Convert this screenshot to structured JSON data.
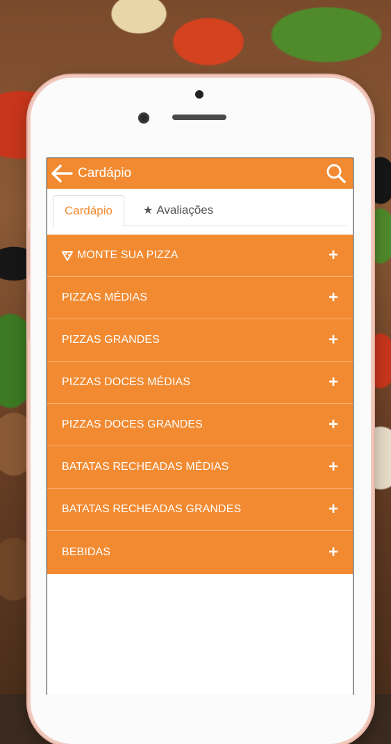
{
  "app": {
    "title": "Cardápio"
  },
  "tabs": [
    {
      "label": "Cardápio",
      "active": true
    },
    {
      "label": "Avaliações",
      "active": false,
      "icon": "star-icon"
    }
  ],
  "menu": {
    "items": [
      {
        "label": "MONTE SUA PIZZA",
        "icon": "pizza-slice-icon"
      },
      {
        "label": "PIZZAS MÉDIAS"
      },
      {
        "label": "PIZZAS GRANDES"
      },
      {
        "label": "PIZZAS DOCES MÉDIAS"
      },
      {
        "label": "PIZZAS DOCES GRANDES"
      },
      {
        "label": "BATATAS RECHEADAS MÉDIAS"
      },
      {
        "label": "BATATAS RECHEADAS GRANDES"
      },
      {
        "label": "BEBIDAS"
      }
    ],
    "expand_symbol": "+"
  },
  "colors": {
    "accent": "#f28a31",
    "divider": "#fbb37a",
    "phone_frame": "#f1c9bd"
  }
}
